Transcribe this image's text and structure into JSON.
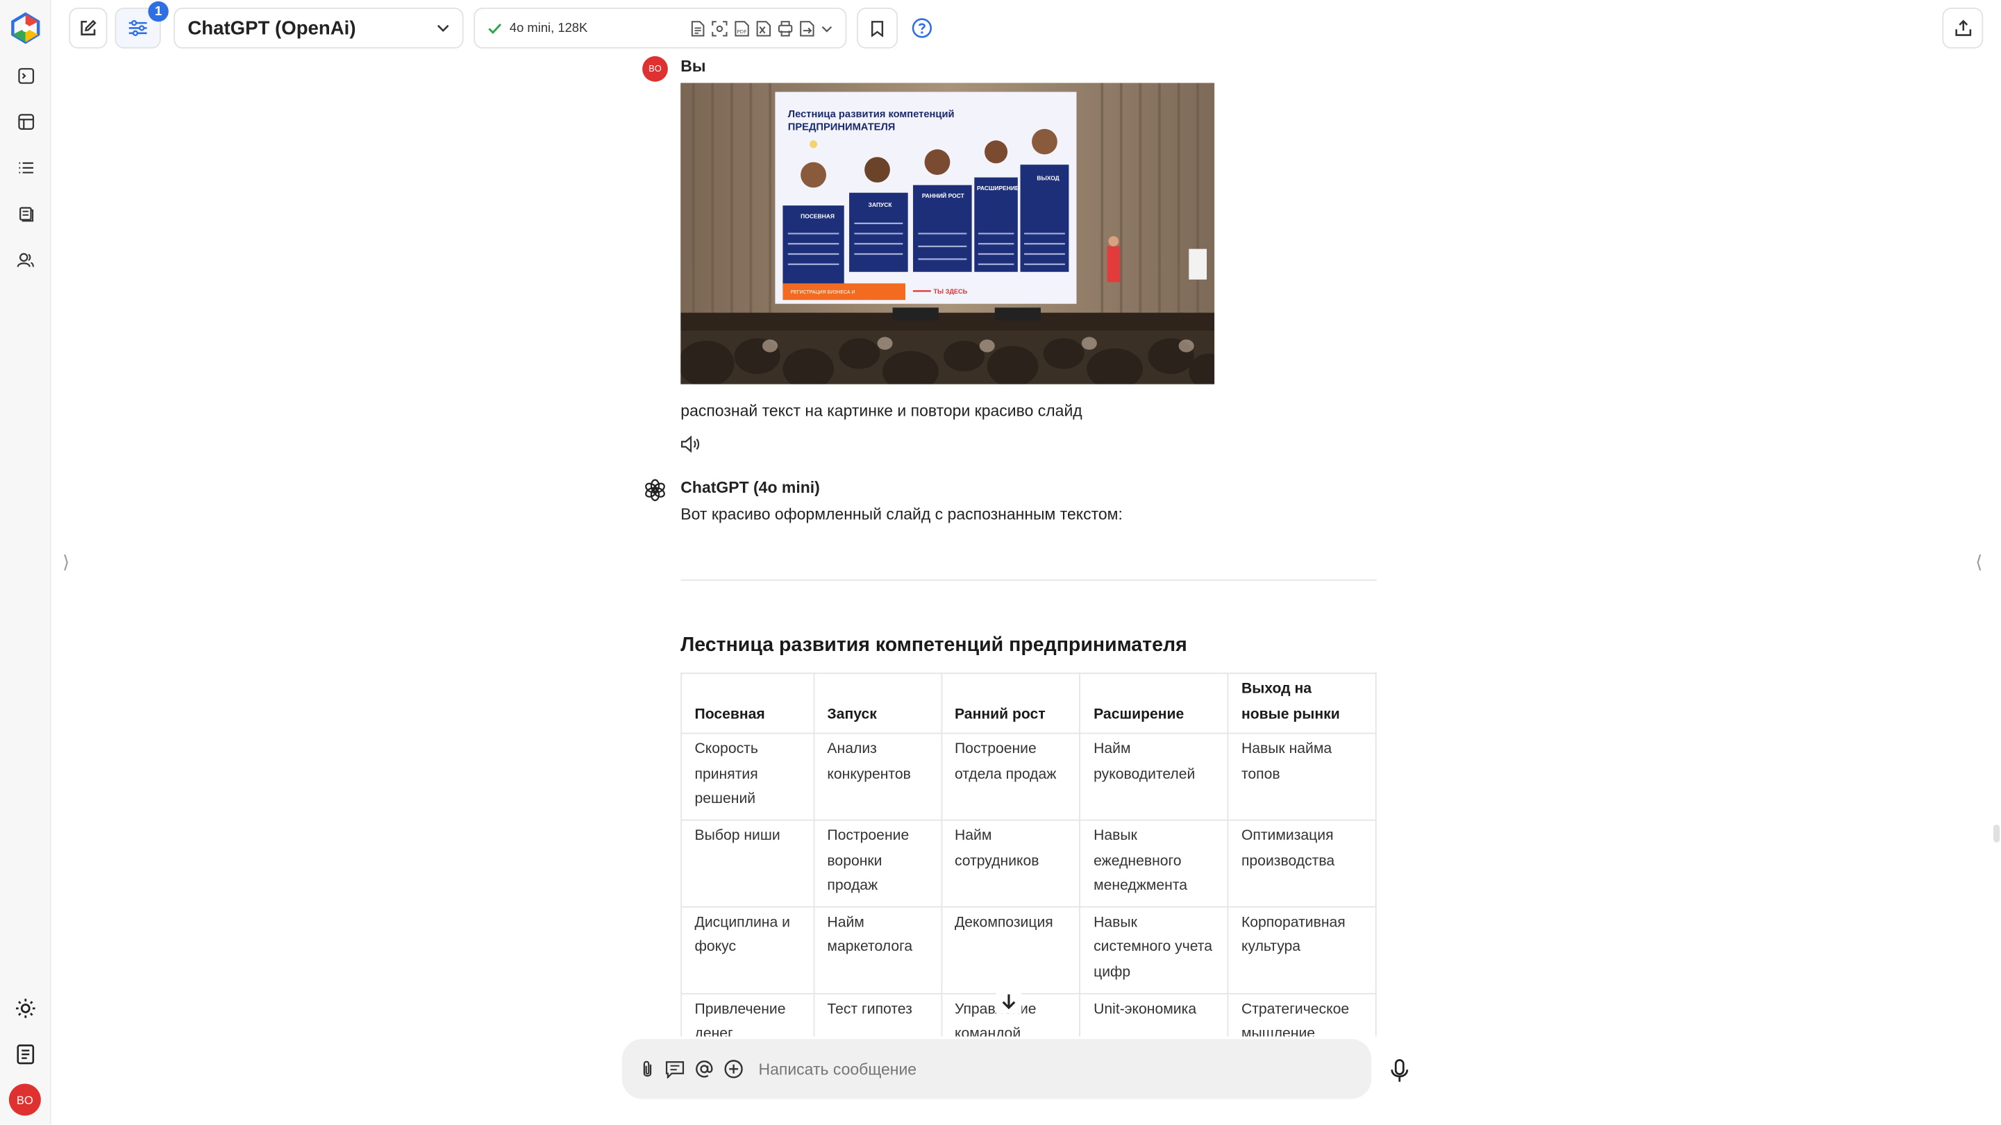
{
  "app": {
    "colors": {
      "accent": "#2f6fe4",
      "avatar": "#e03131",
      "composer_bg": "#f0f0f0"
    }
  },
  "toolbar": {
    "filters_badge": "1",
    "model_name": "ChatGPT (OpenAi)",
    "context_info": "4o mini, 128K"
  },
  "user": {
    "initials": "BO"
  },
  "messages": [
    {
      "author": "Вы",
      "avatar_initials": "BO",
      "text": "распознай текст на картинке и повтори красиво слайд"
    },
    {
      "author": "ChatGPT (4o mini)",
      "intro": "Вот красиво оформленный слайд с распознанным текстом:",
      "heading": "Лестница развития компетенций предпринимателя",
      "table": {
        "headers": [
          "Посевная",
          "Запуск",
          "Ранний рост",
          "Расширение",
          "Выход на новые рынки"
        ],
        "rows": [
          [
            "Скорость принятия решений",
            "Анализ конкурентов",
            "Построение отдела продаж",
            "Найм руководителей",
            "Навык найма топов"
          ],
          [
            "Выбор ниши",
            "Построение воронки продаж",
            "Найм сотрудников",
            "Навык ежедневного менеджмента",
            "Оптимизация производства"
          ],
          [
            "Дисциплина и фокус",
            "Найм маркетолога",
            "Декомпозиция",
            "Навык системного учета цифр",
            "Корпоративная культура"
          ],
          [
            "Привлечение денег",
            "Тест гипотез",
            "Управление командой",
            "Unit-экономика",
            "Стратегическое мышление"
          ]
        ]
      }
    }
  ],
  "slide_photo": {
    "title": "Лестница развития компетенций ПРЕДПРИНИМАТЕЛЯ",
    "columns": [
      "ПОСЕВНАЯ",
      "ЗАПУСК",
      "РАННИЙ РОСТ",
      "РАСШИРЕНИЕ",
      "ВЫХОД НА НОВЫЕ РЫНКИ"
    ],
    "footer": "РЕГИСТРАЦИЯ БИЗНЕСА И ПОЛУЧЕНИЕ МЕР ГОСПОДДЕРЖКИ",
    "you_are_here": "ТЫ ЗДЕСЬ"
  },
  "composer": {
    "placeholder": "Написать сообщение"
  }
}
